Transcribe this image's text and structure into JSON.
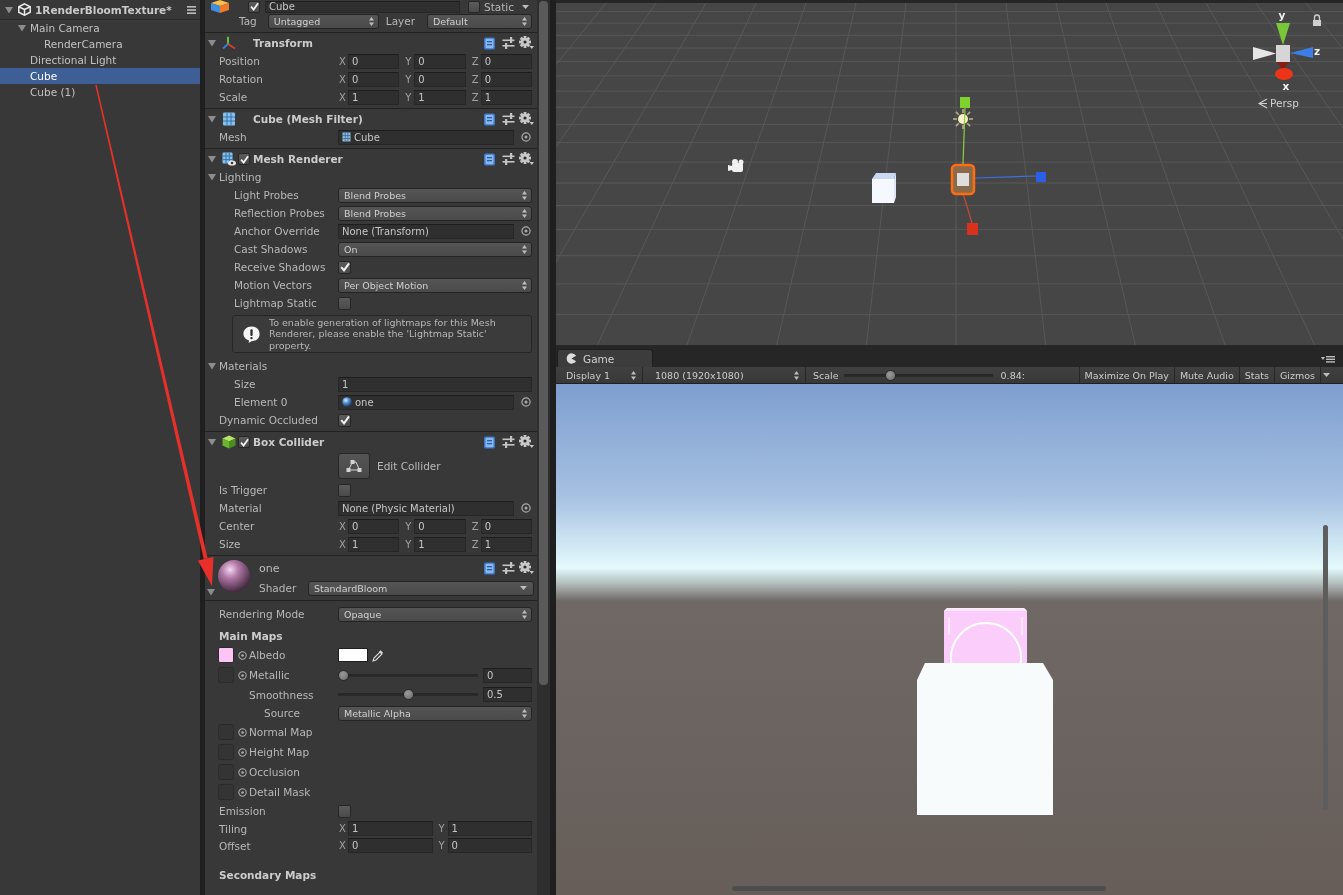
{
  "hierarchy": {
    "title": "1RenderBloomTexture*",
    "expanded": true,
    "items": [
      {
        "label": "Main Camera",
        "selected": false,
        "expanded": true,
        "children": [
          {
            "label": "RenderCamera",
            "selected": false
          }
        ]
      },
      {
        "label": "Directional Light",
        "selected": false
      },
      {
        "label": "Cube",
        "selected": true
      },
      {
        "label": "Cube (1)",
        "selected": false
      }
    ]
  },
  "inspector": {
    "object": {
      "active": true,
      "name": "Cube",
      "static": {
        "label": "Static",
        "checked": false
      },
      "tag": {
        "label": "Tag",
        "value": "Untagged"
      },
      "layer": {
        "label": "Layer",
        "value": "Default"
      }
    },
    "components": [
      {
        "kind": "transform",
        "title": "Transform",
        "expanded": true,
        "rows": [
          {
            "kind": "vector",
            "label": "Position",
            "values": [
              {
                "axis": "X",
                "value": "0"
              },
              {
                "axis": "Y",
                "value": "0"
              },
              {
                "axis": "Z",
                "value": "0"
              }
            ]
          },
          {
            "kind": "vector",
            "label": "Rotation",
            "values": [
              {
                "axis": "X",
                "value": "0"
              },
              {
                "axis": "Y",
                "value": "0"
              },
              {
                "axis": "Z",
                "value": "0"
              }
            ]
          },
          {
            "kind": "vector",
            "label": "Scale",
            "values": [
              {
                "axis": "X",
                "value": "1"
              },
              {
                "axis": "Y",
                "value": "1"
              },
              {
                "axis": "Z",
                "value": "1"
              }
            ]
          }
        ]
      },
      {
        "kind": "mesh_filter",
        "title": "Cube (Mesh Filter)",
        "expanded": true,
        "rows": [
          {
            "kind": "object",
            "label": "Mesh",
            "value": "Cube",
            "asset": {
              "kind": "mesh"
            }
          }
        ]
      },
      {
        "kind": "mesh_renderer",
        "title": "Mesh Renderer",
        "enabled": true,
        "expanded": true,
        "rows": [
          {
            "kind": "section",
            "label": "Lighting",
            "expanded": true,
            "children": [
              {
                "kind": "dropdown",
                "label": "Light Probes",
                "value": "Blend Probes"
              },
              {
                "kind": "dropdown",
                "label": "Reflection Probes",
                "value": "Blend Probes"
              },
              {
                "kind": "object",
                "label": "Anchor Override",
                "value": "None (Transform)"
              },
              {
                "kind": "dropdown",
                "label": "Cast Shadows",
                "value": "On"
              },
              {
                "kind": "checkbox",
                "label": "Receive Shadows",
                "checked": true
              },
              {
                "kind": "dropdown",
                "label": "Motion Vectors",
                "value": "Per Object Motion"
              },
              {
                "kind": "checkbox",
                "label": "Lightmap Static",
                "checked": false
              },
              {
                "kind": "help",
                "text": "To enable generation of lightmaps for this Mesh Renderer, please enable the 'Lightmap Static' property."
              }
            ]
          },
          {
            "kind": "section",
            "label": "Materials",
            "expanded": true,
            "children": [
              {
                "kind": "text",
                "label": "Size",
                "value": "1"
              },
              {
                "kind": "object",
                "label": "Element 0",
                "value": "one",
                "asset": {
                  "kind": "material"
                }
              }
            ]
          },
          {
            "kind": "checkbox",
            "label": "Dynamic Occluded",
            "checked": true
          }
        ]
      },
      {
        "kind": "box_collider",
        "title": "Box Collider",
        "enabled": true,
        "expanded": true,
        "rows": [
          {
            "kind": "edit_button",
            "label": "Edit Collider",
            "selected": false
          },
          {
            "kind": "checkbox",
            "label": "Is Trigger",
            "checked": false
          },
          {
            "kind": "object",
            "label": "Material",
            "value": "None (Physic Material)"
          },
          {
            "kind": "vector",
            "label": "Center",
            "values": [
              {
                "axis": "X",
                "value": "0"
              },
              {
                "axis": "Y",
                "value": "0"
              },
              {
                "axis": "Z",
                "value": "0"
              }
            ]
          },
          {
            "kind": "vector",
            "label": "Size",
            "values": [
              {
                "axis": "X",
                "value": "1"
              },
              {
                "axis": "Y",
                "value": "1"
              },
              {
                "axis": "Z",
                "value": "1"
              }
            ]
          }
        ]
      },
      {
        "kind": "material",
        "title": "one",
        "expanded": true,
        "shader": {
          "label": "Shader",
          "value": "StandardBloom"
        },
        "rows": [
          {
            "kind": "dropdown",
            "label": "Rendering Mode",
            "value": "Opaque"
          },
          {
            "kind": "heading",
            "label": "Main Maps"
          },
          {
            "kind": "texture",
            "label": "Albedo",
            "color": "#ffc4f6",
            "swatch": {
              "color": "#ffffff"
            }
          },
          {
            "kind": "texture",
            "label": "Metallic",
            "level": 0,
            "value": "0",
            "children": [
              {
                "kind": "slider",
                "label": "Smoothness",
                "level": 0.5,
                "value": "0.5",
                "children": [
                  {
                    "kind": "dropdown",
                    "label": "Source",
                    "value": "Metallic Alpha"
                  }
                ]
              }
            ]
          },
          {
            "kind": "texture",
            "label": "Normal Map"
          },
          {
            "kind": "texture",
            "label": "Height Map"
          },
          {
            "kind": "texture",
            "label": "Occlusion"
          },
          {
            "kind": "texture",
            "label": "Detail Mask"
          },
          {
            "kind": "checkbox",
            "label": "Emission",
            "checked": false
          },
          {
            "kind": "vector",
            "label": "Tiling",
            "values": [
              {
                "axis": "X",
                "value": "1"
              },
              {
                "axis": "Y",
                "value": "1"
              }
            ]
          },
          {
            "kind": "vector",
            "label": "Offset",
            "values": [
              {
                "axis": "X",
                "value": "0"
              },
              {
                "axis": "Y",
                "value": "0"
              }
            ]
          },
          {
            "kind": "heading",
            "label": "Secondary Maps"
          }
        ]
      }
    ]
  },
  "scene_view": {
    "axes": [
      {
        "label": "y"
      },
      {
        "label": "z"
      },
      {
        "label": "x"
      }
    ],
    "projection": "Persp"
  },
  "game_view": {
    "tab": {
      "label": "Game",
      "selected": true
    },
    "display": "Display 1",
    "resolution": "1080 (1920x1080)",
    "scale": {
      "label": "Scale",
      "level": 0.3,
      "value": "0.84:"
    },
    "toggles": [
      {
        "label": "Maximize On Play",
        "on": false
      },
      {
        "label": "Mute Audio",
        "on": false
      },
      {
        "label": "Stats",
        "on": false
      },
      {
        "label": "Gizmos",
        "on": false
      }
    ]
  }
}
